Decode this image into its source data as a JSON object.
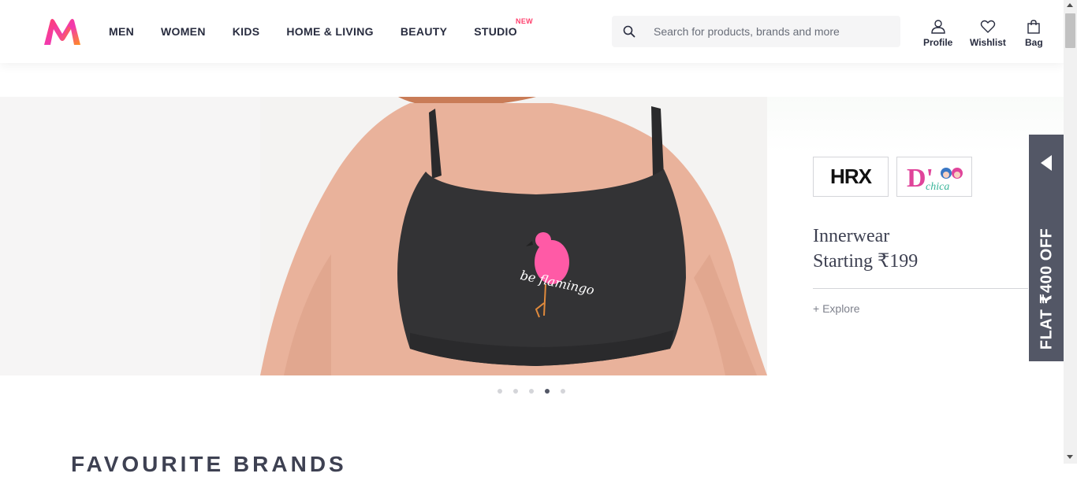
{
  "header": {
    "nav": [
      {
        "label": "MEN"
      },
      {
        "label": "WOMEN"
      },
      {
        "label": "KIDS"
      },
      {
        "label": "HOME & LIVING"
      },
      {
        "label": "BEAUTY"
      },
      {
        "label": "STUDIO",
        "tag": "NEW"
      }
    ],
    "search": {
      "placeholder": "Search for products, brands and more",
      "icon": "search-icon"
    },
    "actions": [
      {
        "label": "Profile",
        "icon": "profile-icon"
      },
      {
        "label": "Wishlist",
        "icon": "heart-icon"
      },
      {
        "label": "Bag",
        "icon": "bag-icon"
      }
    ]
  },
  "banner": {
    "print_text": "be flamingo",
    "brands": [
      "HRX",
      "Dchica"
    ],
    "title_line1": "Innerwear",
    "title_line2": "Starting ₹199",
    "explore": "+ Explore",
    "active_slide": 4,
    "slide_count": 5
  },
  "side_tab": {
    "label": "FLAT ₹400 OFF"
  },
  "section": {
    "title": "FAVOURITE BRANDS"
  },
  "colors": {
    "accent": "#ff3f6c",
    "text": "#282c3f",
    "side_tab": "#535766"
  }
}
